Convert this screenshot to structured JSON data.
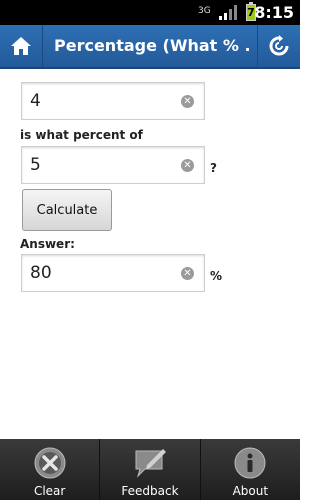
{
  "status": {
    "time": "8:15",
    "network": "3G",
    "battery_level": "7"
  },
  "app": {
    "title": "Percentage (What % ..."
  },
  "form": {
    "first_value": "4",
    "label_middle": "is what percent of",
    "second_value": "5",
    "question_mark": "?",
    "calculate_label": "Calculate",
    "answer_label": "Answer:",
    "answer_value": "80",
    "percent_sign": "%"
  },
  "toolbar": {
    "clear_label": "Clear",
    "feedback_label": "Feedback",
    "about_label": "About"
  },
  "colors": {
    "app_bar": "#2e6fb5",
    "status_bar": "#000000",
    "toolbar": "#2a2a2a"
  }
}
